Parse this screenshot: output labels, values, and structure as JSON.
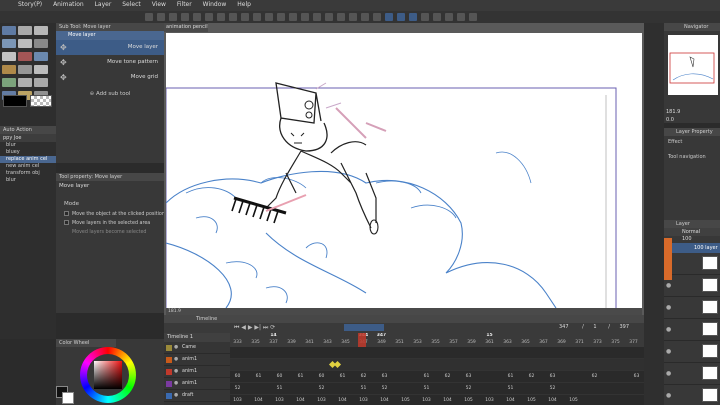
{
  "menubar": {
    "items": [
      "Story(P)",
      "Animation",
      "Layer",
      "Select",
      "View",
      "Filter",
      "Window",
      "Help"
    ]
  },
  "subtool_panel": {
    "title": "Sub Tool: Move layer",
    "tab": "Move layer",
    "items": [
      "Move layer",
      "Move tone pattern",
      "Move grid"
    ],
    "selected": "Move layer",
    "add_label": "Add sub tool"
  },
  "tool_property": {
    "title": "Tool property: Move layer",
    "tool_name": "Move layer",
    "mode_label": "Mode",
    "options": [
      {
        "label": "Move the object at the clicked position",
        "checked": false
      },
      {
        "label": "Move layers in the selected area",
        "checked": false
      },
      {
        "label": "Moved layers become selected",
        "checked": false,
        "disabled": true
      }
    ]
  },
  "auto_action": {
    "title": "Auto Action",
    "set": "ppy Joe",
    "items": [
      "blur",
      "bluey",
      "replace anim cel",
      "new anim cel",
      "transform obj",
      "blur"
    ],
    "selected": "replace anim cel"
  },
  "canvas": {
    "tab_label": "animation pencil*",
    "size_readout": "181.9",
    "angle_readout": "0.0"
  },
  "timeline": {
    "title": "Timeline",
    "track_name": "Timeline 1",
    "current_frame": "347",
    "frame_of": "1",
    "total": "397",
    "markers": [
      "14",
      "344",
      "347",
      "15"
    ],
    "frame_numbers": [
      "333",
      "335",
      "337",
      "339",
      "341",
      "343",
      "345",
      "347",
      "349",
      "351",
      "353",
      "355",
      "357",
      "359",
      "361",
      "363",
      "365",
      "367",
      "369",
      "371",
      "373",
      "375",
      "377"
    ],
    "tracks": [
      {
        "name": "Came",
        "cells": []
      },
      {
        "name": "anim1",
        "cells": []
      },
      {
        "name": "anim1",
        "cells": [
          "60",
          "61",
          "60",
          "61",
          "60",
          "61",
          "62",
          "63",
          "",
          "61",
          "62",
          "63",
          "",
          "61",
          "62",
          "63",
          "",
          "62",
          "",
          "63"
        ]
      },
      {
        "name": "anim1",
        "cells": [
          "52",
          "",
          "51",
          "",
          "52",
          "",
          "51",
          "52",
          "",
          "51",
          "",
          "52",
          "",
          "51",
          "",
          "52"
        ]
      },
      {
        "name": "draft",
        "cells": [
          "103",
          "104",
          "103",
          "104",
          "103",
          "104",
          "103",
          "104",
          "105",
          "103",
          "104",
          "105",
          "103",
          "104",
          "105",
          "104",
          "105"
        ]
      }
    ]
  },
  "navigator": {
    "title": "Navigator",
    "zoom": "181.9",
    "rotation": "0.0"
  },
  "layer_property": {
    "title": "Layer Property",
    "effect_label": "Effect",
    "tool_nav_label": "Tool navigation"
  },
  "layer_panel": {
    "title": "Layer",
    "blend": "Normal",
    "opacity": "100",
    "layer_label": "100 layer"
  },
  "colors": {
    "accent": "#3d5c87",
    "selected_row": "#4a6790",
    "marker_red": "#c0392b",
    "canvas_blue": "#4a82c9"
  },
  "color_wheel": {
    "title": "Color Wheel",
    "main_color": "#111111",
    "sub_color": "#ffffff"
  }
}
